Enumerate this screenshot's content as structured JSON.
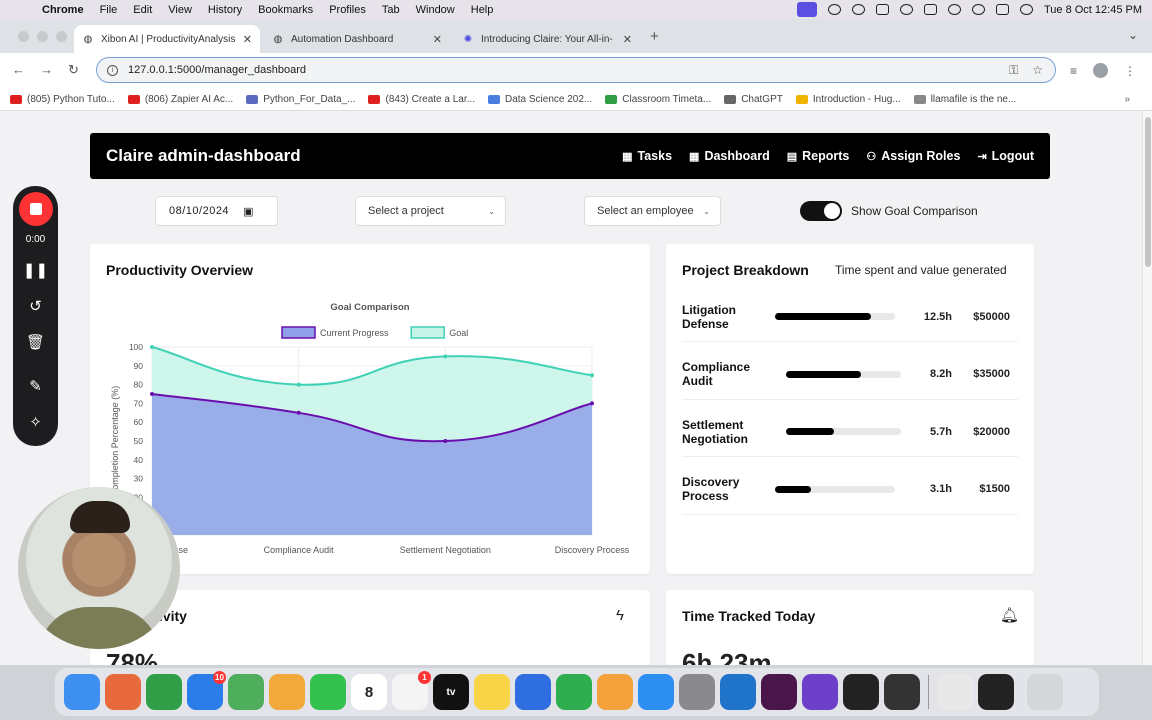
{
  "menubar": {
    "apple": "",
    "app": "Chrome",
    "items": [
      "File",
      "Edit",
      "View",
      "History",
      "Bookmarks",
      "Profiles",
      "Tab",
      "Window",
      "Help"
    ],
    "clock": "Tue 8 Oct  12:45 PM"
  },
  "tabs": [
    {
      "title": "Xibon AI | ProductivityAnalysis",
      "active": true,
      "color": "#5f6368"
    },
    {
      "title": "Automation Dashboard",
      "active": false,
      "color": "#5f6368"
    },
    {
      "title": "Introducing Claire: Your All-in-",
      "active": false,
      "color": "#4a47e0"
    }
  ],
  "toolbar": {
    "url": "127.0.0.1:5000/manager_dashboard"
  },
  "bookmarks": [
    {
      "label": "(805) Python Tuto...",
      "color": "#e02020"
    },
    {
      "label": "(806) Zapier AI Ac...",
      "color": "#e02020"
    },
    {
      "label": "Python_For_Data_...",
      "color": "#5c6bc0"
    },
    {
      "label": "(843) Create a Lar...",
      "color": "#e02020"
    },
    {
      "label": "Data Science 202...",
      "color": "#4a7de0"
    },
    {
      "label": "Classroom Timeta...",
      "color": "#2e9e44"
    },
    {
      "label": "ChatGPT",
      "color": "#666666"
    },
    {
      "label": "Introduction - Hug...",
      "color": "#f0b400"
    },
    {
      "label": "llamafile is the ne...",
      "color": "#888888"
    }
  ],
  "navbar": {
    "brand": "Claire admin-dashboard",
    "links": [
      {
        "icon": "▦",
        "label": "Tasks"
      },
      {
        "icon": "▦",
        "label": "Dashboard"
      },
      {
        "icon": "▤",
        "label": "Reports"
      },
      {
        "icon": "⚇",
        "label": "Assign Roles"
      },
      {
        "icon": "⇥",
        "label": "Logout"
      }
    ]
  },
  "controls": {
    "date": "08/10/2024",
    "project_select": "Select a project",
    "employee_select": "Select an employee",
    "toggle_label": "Show Goal Comparison",
    "toggle_on": true
  },
  "overview": {
    "title": "Productivity Overview"
  },
  "chart_data": {
    "type": "area",
    "title": "Goal Comparison",
    "ylabel": "Completion Percentage (%)",
    "xlabel": "",
    "categories": [
      "Litigation Defense",
      "Compliance Audit",
      "Settlement Negotiation",
      "Discovery Process"
    ],
    "ylim": [
      0,
      100
    ],
    "yticks": [
      0,
      10,
      20,
      30,
      40,
      50,
      60,
      70,
      80,
      90,
      100
    ],
    "legend_position": "top",
    "series": [
      {
        "name": "Current Progress",
        "values": [
          75,
          65,
          50,
          70
        ],
        "color": "#6a0dad",
        "fill": "#8fa0e8"
      },
      {
        "name": "Goal",
        "values": [
          100,
          80,
          95,
          85
        ],
        "color": "#3fd1b5",
        "fill": "#c6f4e7"
      }
    ]
  },
  "breakdown": {
    "title": "Project Breakdown",
    "subtitle": "Time spent and value generated",
    "rows": [
      {
        "name": "Litigation Defense",
        "hours": "12.5h",
        "value": "$50000",
        "fill": 0.8
      },
      {
        "name": "Compliance Audit",
        "hours": "8.2h",
        "value": "$35000",
        "fill": 0.65
      },
      {
        "name": "Settlement Negotiation",
        "hours": "5.7h",
        "value": "$20000",
        "fill": 0.42
      },
      {
        "name": "Discovery Process",
        "hours": "3.1h",
        "value": "$1500",
        "fill": 0.3
      }
    ]
  },
  "productivity_card": {
    "title": "Productivity",
    "value": "78%"
  },
  "time_card": {
    "title": "Time Tracked Today",
    "value": "6h 23m"
  },
  "recorder": {
    "time": "0:00"
  },
  "dock": [
    {
      "name": "finder",
      "color": "#3d8ff0",
      "label": ""
    },
    {
      "name": "launchpad",
      "color": "#e86a3c",
      "label": ""
    },
    {
      "name": "chrome",
      "color": "#2f9e44",
      "label": ""
    },
    {
      "name": "mail",
      "color": "#2b7de9",
      "label": "",
      "badge": "10"
    },
    {
      "name": "maps",
      "color": "#4fae5c",
      "label": ""
    },
    {
      "name": "photos",
      "color": "#f2a93b",
      "label": ""
    },
    {
      "name": "facetime",
      "color": "#33c24d",
      "label": ""
    },
    {
      "name": "calendar",
      "color": "#ffffff",
      "label": "8"
    },
    {
      "name": "reminders",
      "color": "#f4f4f4",
      "label": "",
      "badge": "1"
    },
    {
      "name": "tv",
      "color": "#111111",
      "label": "tv"
    },
    {
      "name": "notes",
      "color": "#f7d547",
      "label": ""
    },
    {
      "name": "keynote",
      "color": "#2e6ee0",
      "label": ""
    },
    {
      "name": "numbers",
      "color": "#2fae4f",
      "label": ""
    },
    {
      "name": "pages",
      "color": "#f3a13a",
      "label": ""
    },
    {
      "name": "app-store",
      "color": "#2b8ef0",
      "label": ""
    },
    {
      "name": "settings",
      "color": "#8a8a8e",
      "label": ""
    },
    {
      "name": "vscode",
      "color": "#1f73c9",
      "label": ""
    },
    {
      "name": "slack",
      "color": "#4a154b",
      "label": ""
    },
    {
      "name": "github",
      "color": "#6e40c9",
      "label": ""
    },
    {
      "name": "unity",
      "color": "#222222",
      "label": ""
    },
    {
      "name": "chatgpt",
      "color": "#333333",
      "label": ""
    },
    {
      "name": "window-preview",
      "color": "#e8e8e8",
      "label": ""
    },
    {
      "name": "terminal-preview",
      "color": "#222222",
      "label": ""
    },
    {
      "name": "trash",
      "color": "#d4d6da",
      "label": ""
    }
  ]
}
